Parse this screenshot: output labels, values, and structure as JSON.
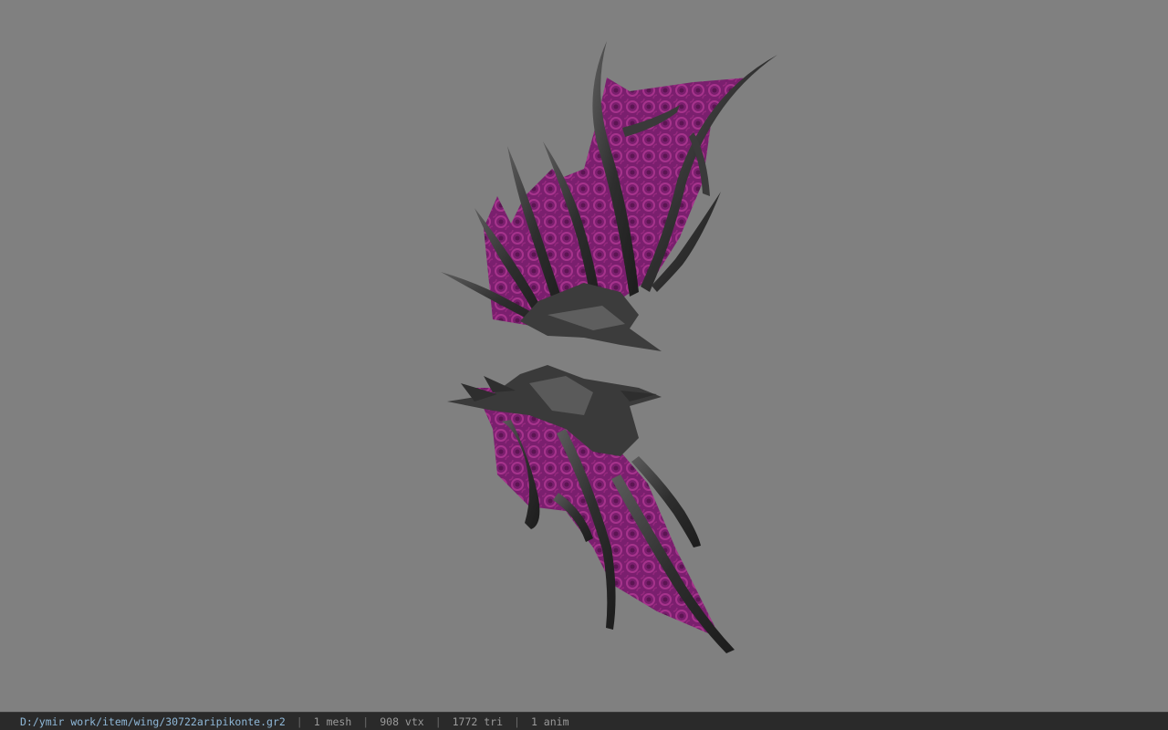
{
  "viewport": {
    "background": "#808080",
    "model_colors": {
      "membrane": "#7a1f6e",
      "membrane_highlight": "#b0368f",
      "bone": "#2f2f2f",
      "bone_highlight": "#5a5a5a"
    }
  },
  "status": {
    "file_path": "D:/ymir work/item/wing/30722aripikonte.gr2",
    "separator": "|",
    "mesh": "1 mesh",
    "vertices": "908 vtx",
    "triangles": "1772 tri",
    "animations": "1 anim"
  }
}
